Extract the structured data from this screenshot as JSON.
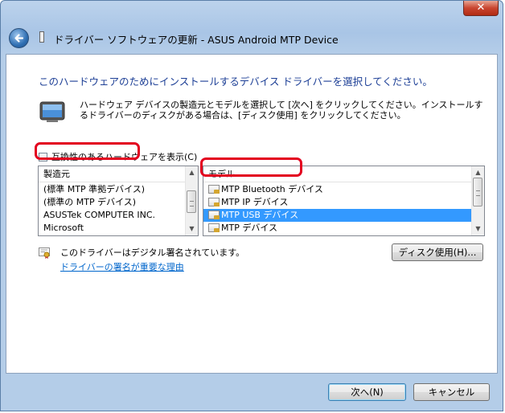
{
  "window": {
    "title": "ドライバー ソフトウェアの更新 - ASUS Android MTP Device",
    "close_glyph": "✕"
  },
  "main": {
    "heading": "このハードウェアのためにインストールするデバイス ドライバーを選択してください。",
    "description": "ハードウェア デバイスの製造元とモデルを選択して [次へ] をクリックしてください。インストールするドライバーのディスクがある場合は、[ディスク使用] をクリックしてください。",
    "show_compatible_label": "互換性のあるハードウェアを表示(C)",
    "show_compatible_checked": false
  },
  "manufacturer_list": {
    "header": "製造元",
    "items": [
      "(標準 MTP 準拠デバイス)",
      "(標準の MTP デバイス)",
      "ASUSTek COMPUTER INC.",
      "Microsoft"
    ],
    "highlighted_item": "(標準の MTP デバイス)"
  },
  "model_list": {
    "header": "モデル",
    "items": [
      "MTP Bluetooth デバイス",
      "MTP IP デバイス",
      "MTP USB デバイス",
      "MTP デバイス"
    ],
    "selected_item": "MTP USB デバイス"
  },
  "signature": {
    "text": "このドライバーはデジタル署名されています。",
    "link": "ドライバーの署名が重要な理由"
  },
  "buttons": {
    "have_disk": "ディスク使用(H)...",
    "next": "次へ(N)",
    "cancel": "キャンセル"
  },
  "colors": {
    "highlight_border": "#e3001f",
    "selection": "#3399ff",
    "heading": "#1d3f96",
    "link": "#0066cc"
  }
}
